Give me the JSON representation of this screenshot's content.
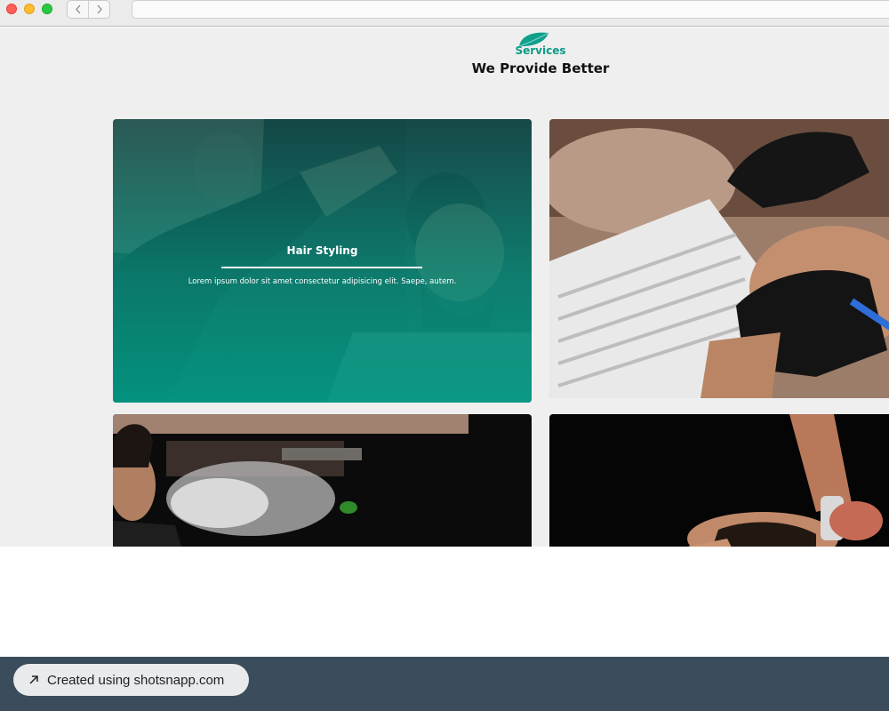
{
  "browser": {
    "icons": {
      "back": "chevron-left-icon",
      "forward": "chevron-right-icon"
    },
    "window_buttons": {
      "close": "#fe5f57",
      "minimize": "#febc2e",
      "zoom": "#28c840"
    }
  },
  "section": {
    "eyebrow": "Services",
    "title": "We Provide Better",
    "accent_color": "#0d9b87"
  },
  "services": [
    {
      "title": "Hair Styling",
      "description": "Lorem ipsum dolor sit amet consectetur adipisicing elit. Saepe, autem.",
      "image": "woman-cutting-mans-hair-photo"
    },
    {
      "image": "beard-shaving-with-gloves-photo"
    },
    {
      "image": "hair-spray-barber-photo"
    },
    {
      "image": "man-getting-hair-treatment-photo"
    }
  ],
  "footer": {
    "credit": "Created using shotsnapp.com",
    "icon": "arrow-up-right-icon",
    "background": "#3b4d5c"
  }
}
